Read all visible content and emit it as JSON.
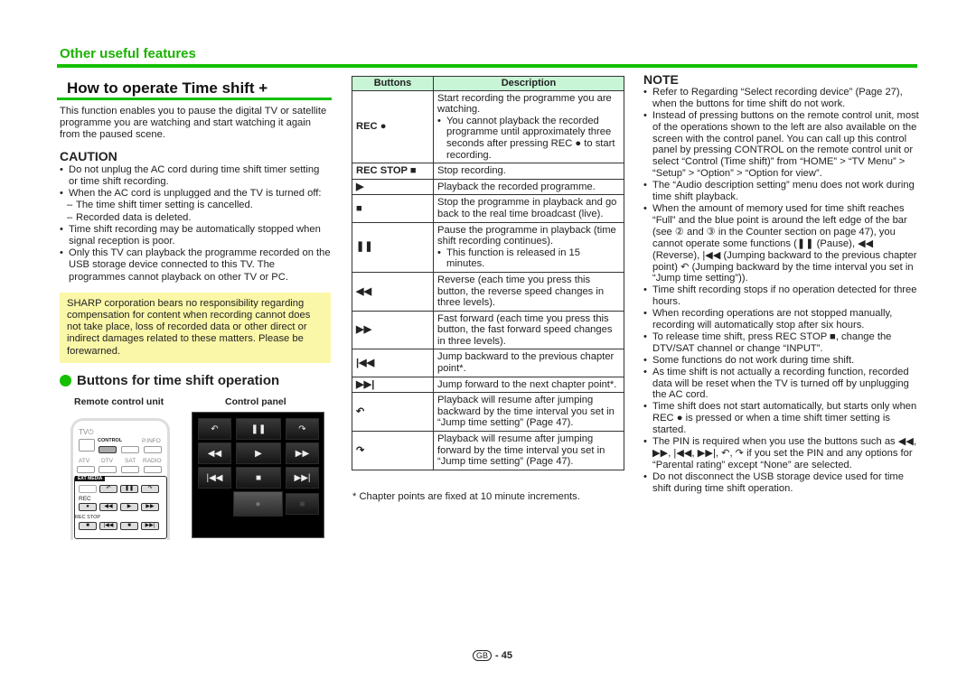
{
  "header": {
    "section": "Other useful features",
    "title": "How to operate Time shift +",
    "colors": {
      "accent_green": "#14c000",
      "notice_bg": "#fbf7a8",
      "table_header_bg": "#c7f5d6"
    }
  },
  "left": {
    "intro": "This function enables you to pause the digital TV or satellite programme you are watching and start watching it again from the paused scene.",
    "caution_heading": "CAUTION",
    "caution_items": [
      "Do not unplug the AC cord during time shift timer setting or time shift recording.",
      "When the AC cord is unplugged and the TV is turned off:",
      "Time shift recording may be automatically stopped when signal reception is poor.",
      "Only this TV can playback the programme recorded on the USB storage device connected to this TV. The programmes cannot playback on other TV or PC."
    ],
    "caution_subitems": [
      "The time shift timer setting is cancelled.",
      "Recorded data is deleted."
    ],
    "notice": "SHARP corporation bears no responsibility regarding compensation for content when recording cannot does not take place, loss of recorded data or other direct or indirect damages related to these matters. Please be forewarned.",
    "buttons_heading": "Buttons for time shift operation",
    "remote_label": "Remote control unit",
    "panel_label": "Control panel",
    "remote": {
      "tv_power": "TV⏻",
      "control": "CONTROL",
      "pinfo": "P.INFO",
      "atv": "ATV",
      "dtv": "DTV",
      "sat": "SAT",
      "radio": "RADIO",
      "ext_media": "EXT MEDIA",
      "rec": "REC",
      "rec_stop": "REC STOP"
    },
    "panel_buttons": [
      "↶",
      "❚❚",
      "↷",
      "◀◀",
      "▶",
      "▶▶",
      "|◀◀",
      "■",
      "▶▶|",
      "●",
      "■"
    ]
  },
  "table": {
    "headers": [
      "Buttons",
      "Description"
    ],
    "rows": [
      {
        "button": "REC ●",
        "desc": "Start recording the programme you are watching.",
        "sub": "You cannot playback the recorded programme until approximately three seconds after pressing REC ● to start recording."
      },
      {
        "button": "REC STOP ■",
        "desc": "Stop recording.",
        "sub": ""
      },
      {
        "button": "▶",
        "desc": "Playback the recorded programme.",
        "sub": ""
      },
      {
        "button": "■",
        "desc": "Stop the programme in playback and go back to the real time broadcast (live).",
        "sub": ""
      },
      {
        "button": "❚❚",
        "desc": "Pause the programme in playback (time shift recording continues).",
        "sub": "This function is released in 15 minutes."
      },
      {
        "button": "◀◀",
        "desc": "Reverse (each time you press this button, the reverse speed changes in three levels).",
        "sub": ""
      },
      {
        "button": "▶▶",
        "desc": "Fast forward (each time you press this button, the fast forward speed changes in three levels).",
        "sub": ""
      },
      {
        "button": "|◀◀",
        "desc": "Jump backward to the previous chapter point*.",
        "sub": ""
      },
      {
        "button": "▶▶|",
        "desc": "Jump forward to the next chapter point*.",
        "sub": ""
      },
      {
        "button": "↶",
        "desc": "Playback will resume after jumping backward by the time interval you set in “Jump time setting” (Page 47).",
        "sub": ""
      },
      {
        "button": "↷",
        "desc": "Playback will resume after jumping forward by the time interval you set in “Jump time setting” (Page 47).",
        "sub": ""
      }
    ],
    "footnote": "*  Chapter points are fixed at 10 minute increments."
  },
  "note": {
    "heading": "NOTE",
    "items": [
      "Refer to Regarding “Select recording device” (Page 27), when the buttons for time shift do not work.",
      "Instead of pressing buttons on the remote control unit, most of the operations shown to the left are also available on the screen with the control panel. You can call up this control panel by pressing CONTROL on the remote control unit or select “Control (Time shift)” from “HOME” > “TV Menu” > “Setup” > “Option” > “Option for view”.",
      "The “Audio description setting” menu does not work during time shift playback.",
      "When the amount of memory used for time shift reaches “Full” and the blue point is around the left edge of the bar (see ② and ③ in the Counter section on page 47), you cannot operate some functions (❚❚ (Pause), ◀◀ (Reverse), |◀◀ (Jumping backward to the previous chapter point) ↶ (Jumping backward by the time interval you set in “Jump time setting”)).",
      "Time shift recording stops if no operation detected for three hours.",
      "When recording operations are not stopped manually, recording will automatically stop after six hours.",
      "To release time shift, press REC STOP ■, change the DTV/SAT channel or change “INPUT”.",
      "Some functions do not work during time shift.",
      "As time shift is not actually a recording function, recorded data will be reset when the TV is turned off by unplugging the AC cord.",
      "Time shift does not start automatically, but starts only when REC ● is pressed or when a time shift timer setting is started.",
      "The PIN is required when you use the buttons such as ◀◀, ▶▶, |◀◀, ▶▶|, ↶, ↷ if you set the PIN and any options for “Parental rating” except “None” are selected.",
      "Do not disconnect the USB storage device used for time shift during time shift operation."
    ]
  },
  "footer": {
    "region": "GB",
    "page": "- 45"
  }
}
